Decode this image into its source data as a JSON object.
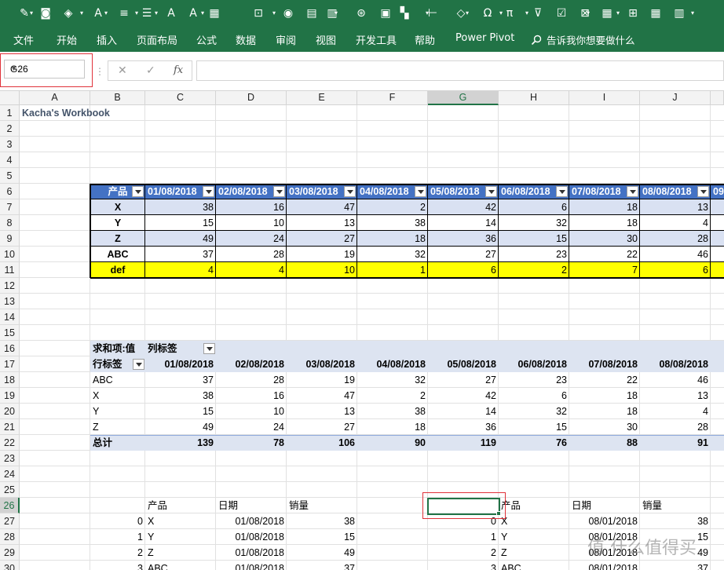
{
  "qat_icons": [
    "brush-icon",
    "camera-icon",
    "fill-color-icon",
    "font-color-icon",
    "align-center-icon",
    "align-justify-icon",
    "font-grow-icon",
    "font-shrink-icon",
    "table-icon",
    "import-icon",
    "database-icon",
    "document-icon",
    "paste-special-icon",
    "refresh-icon",
    "format-cells-icon",
    "color-squares-icon",
    "sort-icon",
    "shapes-icon",
    "omega-icon",
    "pi-icon",
    "filter-icon",
    "checkbox-icon",
    "delete-sheet-icon",
    "calculator-icon",
    "screenshot-icon",
    "grid-icon",
    "slides-icon"
  ],
  "menu": {
    "items": [
      "文件",
      "开始",
      "插入",
      "页面布局",
      "公式",
      "数据",
      "审阅",
      "视图",
      "开发工具",
      "帮助",
      "Power Pivot"
    ],
    "tell_me": "告诉我你想要做什么"
  },
  "formula_bar": {
    "name_box": "G26",
    "cancel": "✕",
    "enter": "✓",
    "fx": "fx",
    "value": ""
  },
  "columns": [
    "A",
    "B",
    "C",
    "D",
    "E",
    "F",
    "G",
    "H",
    "I",
    "J"
  ],
  "rows": [
    "1",
    "2",
    "3",
    "4",
    "5",
    "6",
    "7",
    "8",
    "9",
    "10",
    "11",
    "12",
    "13",
    "14",
    "15",
    "16",
    "17",
    "18",
    "19",
    "20",
    "21",
    "22",
    "23",
    "24",
    "25",
    "26",
    "27",
    "28",
    "29",
    "30"
  ],
  "workbook_title": "Kacha's Workbook",
  "table1": {
    "header": [
      "产品",
      "01/08/2018",
      "02/08/2018",
      "03/08/2018",
      "04/08/2018",
      "05/08/2018",
      "06/08/2018",
      "07/08/2018",
      "08/08/2018",
      "09"
    ],
    "rows": [
      {
        "label": "X",
        "values": [
          "38",
          "16",
          "47",
          "2",
          "42",
          "6",
          "18",
          "13"
        ]
      },
      {
        "label": "Y",
        "values": [
          "15",
          "10",
          "13",
          "38",
          "14",
          "32",
          "18",
          "4"
        ]
      },
      {
        "label": "Z",
        "values": [
          "49",
          "24",
          "27",
          "18",
          "36",
          "15",
          "30",
          "28"
        ]
      },
      {
        "label": "ABC",
        "values": [
          "37",
          "28",
          "19",
          "32",
          "27",
          "23",
          "22",
          "46"
        ]
      },
      {
        "label": "def",
        "values": [
          "4",
          "4",
          "10",
          "1",
          "6",
          "2",
          "7",
          "6"
        ]
      }
    ]
  },
  "pivot": {
    "sum_label": "求和项:值",
    "col_label": "列标签",
    "row_label": "行标签",
    "dates": [
      "01/08/2018",
      "02/08/2018",
      "03/08/2018",
      "04/08/2018",
      "05/08/2018",
      "06/08/2018",
      "07/08/2018",
      "08/08/2018"
    ],
    "rows": [
      {
        "label": "ABC",
        "values": [
          "37",
          "28",
          "19",
          "32",
          "27",
          "23",
          "22",
          "46"
        ]
      },
      {
        "label": "X",
        "values": [
          "38",
          "16",
          "47",
          "2",
          "42",
          "6",
          "18",
          "13"
        ]
      },
      {
        "label": "Y",
        "values": [
          "15",
          "10",
          "13",
          "38",
          "14",
          "32",
          "18",
          "4"
        ]
      },
      {
        "label": "Z",
        "values": [
          "49",
          "24",
          "27",
          "18",
          "36",
          "15",
          "30",
          "28"
        ]
      }
    ],
    "total_label": "总计",
    "totals": [
      "139",
      "78",
      "106",
      "90",
      "119",
      "76",
      "88",
      "91"
    ]
  },
  "df1": {
    "headers": [
      "产品",
      "日期",
      "销量"
    ],
    "rows": [
      {
        "idx": "0",
        "prod": "X",
        "date": "01/08/2018",
        "qty": "38"
      },
      {
        "idx": "1",
        "prod": "Y",
        "date": "01/08/2018",
        "qty": "15"
      },
      {
        "idx": "2",
        "prod": "Z",
        "date": "01/08/2018",
        "qty": "49"
      },
      {
        "idx": "3",
        "prod": "ABC",
        "date": "01/08/2018",
        "qty": "37"
      }
    ]
  },
  "df2": {
    "headers": [
      "产品",
      "日期",
      "销量"
    ],
    "rows": [
      {
        "idx": "0",
        "prod": "X",
        "date": "08/01/2018",
        "qty": "38"
      },
      {
        "idx": "1",
        "prod": "Y",
        "date": "08/01/2018",
        "qty": "15"
      },
      {
        "idx": "2",
        "prod": "Z",
        "date": "08/01/2018",
        "qty": "49"
      },
      {
        "idx": "3",
        "prod": "ABC",
        "date": "08/01/2018",
        "qty": "37"
      }
    ]
  },
  "watermark": "值 什么值得买",
  "colors": {
    "excel_green": "#217346",
    "table_header": "#4472c4",
    "table_band": "#d9e1f2",
    "highlight": "#ffff00",
    "pivot_band": "#dde4f1",
    "annotation_red": "#e0323a"
  }
}
